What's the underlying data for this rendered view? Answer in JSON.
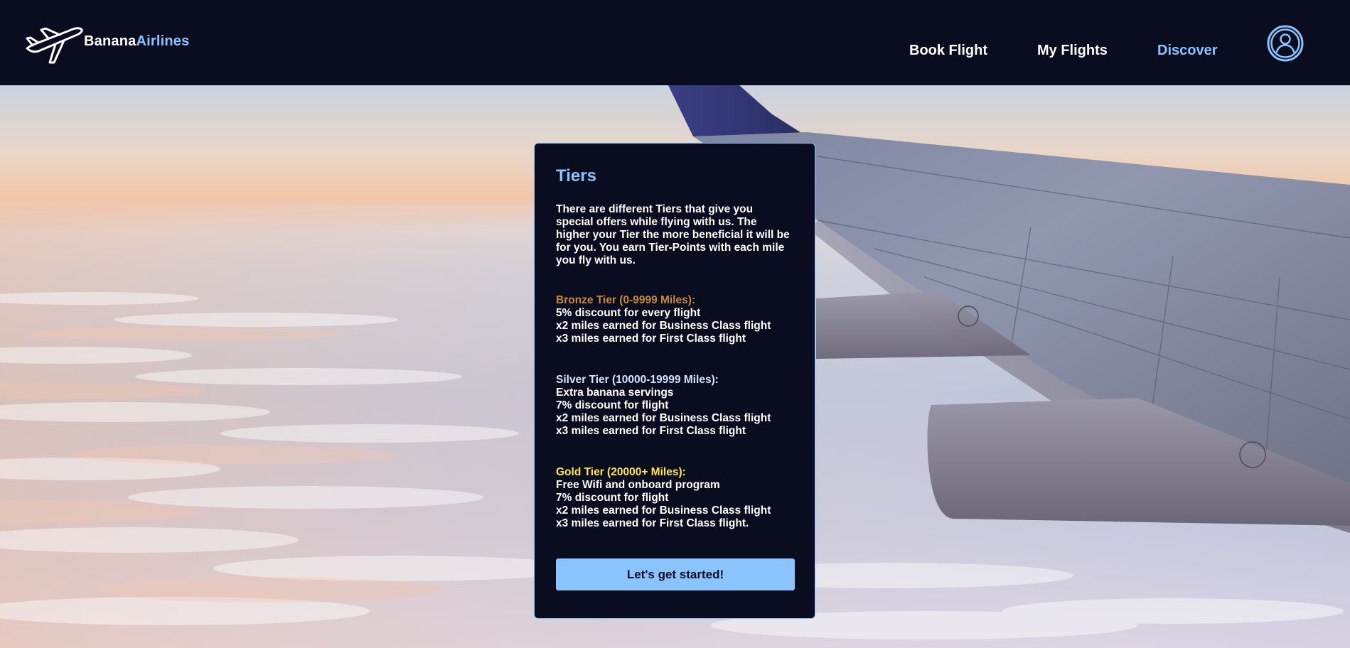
{
  "brand": {
    "name_part1": "Banana",
    "name_part2": "Airlines",
    "icon": "airplane-icon",
    "accent_color": "#8ac4ff",
    "background_color": "#0a0c1f"
  },
  "nav": {
    "items": [
      {
        "label": "Book Flight",
        "active": false
      },
      {
        "label": "My Flights",
        "active": false
      },
      {
        "label": "Discover",
        "active": true
      }
    ],
    "profile_icon": "user-circle-icon"
  },
  "card": {
    "title": "Tiers",
    "intro": "There are different Tiers that give you special offers while flying with us. The higher your Tier the more beneficial it will be for you. You earn Tier-Points with each mile you fly with us.",
    "tiers": [
      {
        "heading": "Bronze Tier (0-9999 Miles):",
        "color": "#c98a2c",
        "perks": [
          "5% discount for every flight",
          "x2 miles earned for Business Class flight",
          "x3 miles earned for First Class flight"
        ]
      },
      {
        "heading": "Silver Tier (10000-19999 Miles):",
        "color": "#cfe6ff",
        "perks": [
          "Extra banana servings",
          "7% discount for flight",
          "x2 miles earned for Business Class flight",
          "x3 miles earned for First Class flight"
        ]
      },
      {
        "heading": "Gold Tier (20000+ Miles):",
        "color": "#ffe83a",
        "perks": [
          "Free Wifi and onboard program",
          "7% discount for flight",
          "x2 miles earned for Business Class flight",
          "x3 miles earned for First Class flight."
        ]
      }
    ],
    "button_label": "Let's get started!"
  }
}
